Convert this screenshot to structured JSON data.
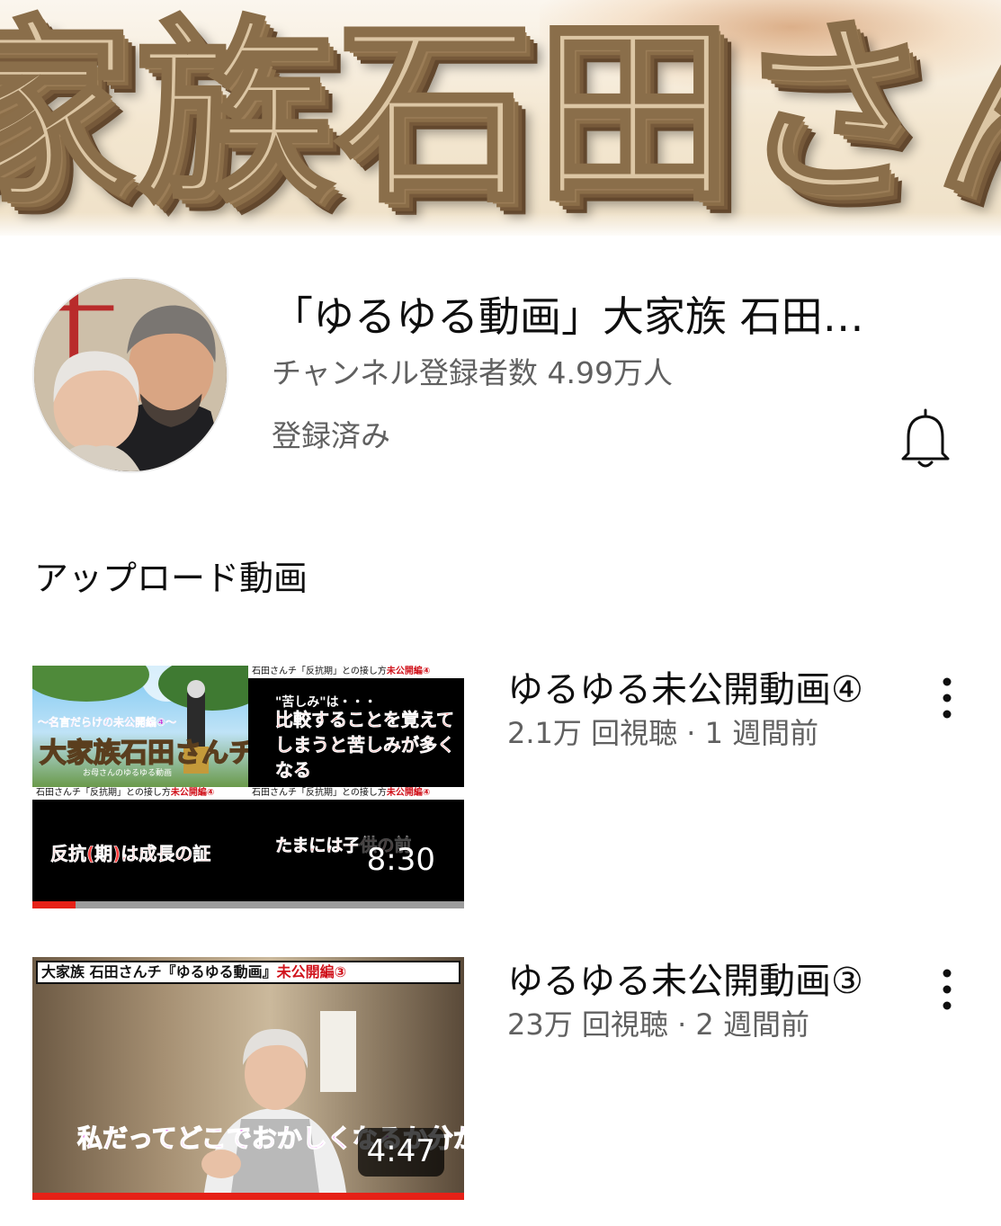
{
  "banner": {
    "text": "家族石田さん"
  },
  "channel": {
    "title": "「ゆるゆる動画」大家族 石田…",
    "subscriber_count": "チャンネル登録者数 4.99万人",
    "subscription_state": "登録済み",
    "notification_icon": "bell-icon"
  },
  "section": {
    "heading": "アップロード動画"
  },
  "videos": [
    {
      "title": "ゆるゆる未公開動画④",
      "meta": "2.1万 回視聴 · 1 週間前",
      "duration": "8:30",
      "watched_fraction": 0.1,
      "thumbnail": {
        "strip_top_right": "石田さんチ「反抗期」との接し方",
        "strip_top_right_hl": "未公開編④",
        "strip_bottom_left": "石田さんチ「反抗期」との接し方",
        "strip_bottom_left_hl": "未公開編④",
        "strip_bottom_right": "石田さんチ「反抗期」との接し方",
        "strip_bottom_right_hl": "未公開編④",
        "quote_lead": "\"苦しみ\"は・・・",
        "quote_body": "比較することを覚えてしまうと苦しみが多くなる",
        "sub_title": "〜名言だらけの未公開編④〜",
        "logo_text": "大家族石田さんチ",
        "logo_caption": "お母さんのゆるゆる動画",
        "bottom_left": "反抗(期)は成長の証",
        "bottom_right": "たまには子供の前"
      }
    },
    {
      "title": "ゆるゆる未公開動画③",
      "meta": "23万 回視聴 · 2 週間前",
      "duration": "4:47",
      "watched_fraction": 1.0,
      "thumbnail": {
        "top_bar": "大家族 石田さんチ『ゆるゆる動画』",
        "top_bar_hl": "未公開編③",
        "caption": "私だってどこでおかしくなるか分からないでしょ"
      }
    }
  ],
  "colors": {
    "progress_red": "#e62117",
    "secondary_text": "#606060",
    "primary_text": "#0f0f0f"
  }
}
